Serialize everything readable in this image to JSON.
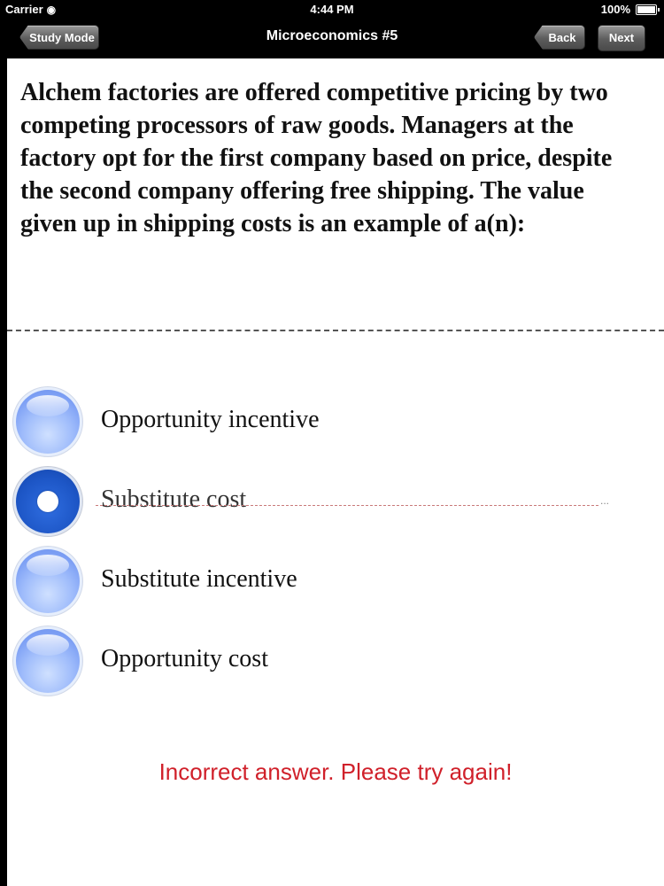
{
  "status_bar": {
    "carrier": "Carrier",
    "time": "4:44 PM",
    "battery": "100%"
  },
  "nav": {
    "title": "Microeconomics #5",
    "study_mode_label": "Study Mode",
    "back_label": "Back",
    "next_label": "Next"
  },
  "question": {
    "text": "Alchem factories are offered competitive pricing by two competing processors of raw goods. Managers at the factory opt for the first company based on price, despite the second company offering free shipping. The value given up in shipping costs is an example of a(n):"
  },
  "options": [
    {
      "label": "Opportunity incentive",
      "selected": false,
      "struck": false
    },
    {
      "label": "Substitute cost",
      "selected": true,
      "struck": true
    },
    {
      "label": "Substitute incentive",
      "selected": false,
      "struck": false
    },
    {
      "label": "Opportunity cost",
      "selected": false,
      "struck": false
    }
  ],
  "feedback": {
    "text": "Incorrect answer. Please try again!",
    "color": "#d0202a"
  },
  "colors": {
    "radio_unselected": "#8fb0f7",
    "radio_selected": "#1d56c6",
    "strike": "#c97a7a"
  }
}
